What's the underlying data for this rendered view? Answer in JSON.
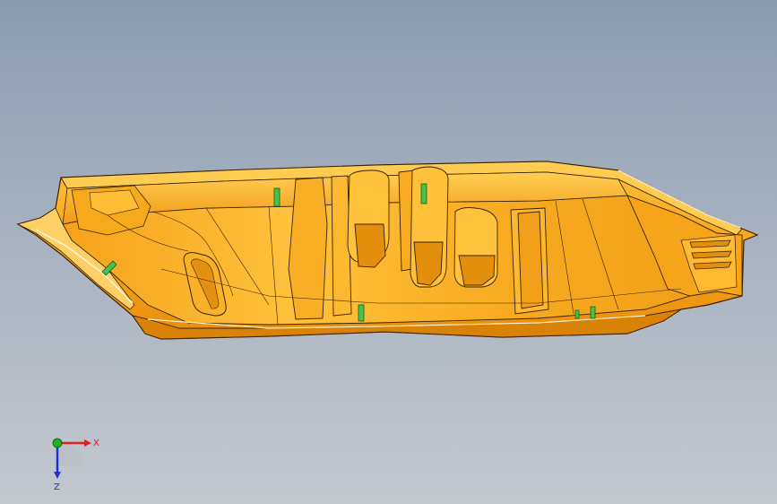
{
  "viewport": {
    "background_top": "#8c9cb0",
    "background_bottom": "#c3c8cf"
  },
  "model": {
    "part_color": "#f6a318",
    "edge_color": "#3a2200",
    "highlight_color": "#ffc84a",
    "shadow_color": "#d9800a",
    "feature_color": "#45c24a"
  },
  "triad": {
    "x_label": "X",
    "z_label": "Z",
    "x_color": "#e02020",
    "y_color": "#20b020",
    "z_color": "#2030d0"
  }
}
